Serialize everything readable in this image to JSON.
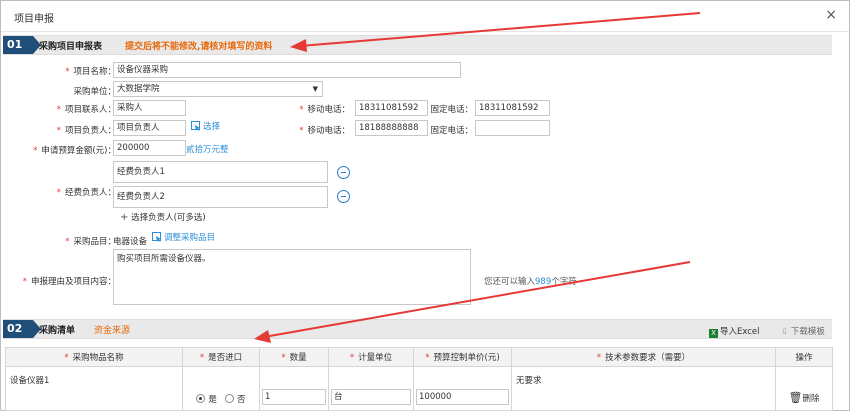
{
  "window": {
    "title": "项目申报",
    "close_glyph": "×"
  },
  "section1": {
    "num": "01",
    "title": "采购项目申报表",
    "note": "提交后将不能修改,请核对填写的资料"
  },
  "form": {
    "project_name_label": "项目名称：",
    "project_name": "设备仪器采购",
    "unit_label": "采购单位：",
    "unit": "大数据学院",
    "contact_label": "项目联系人：",
    "contact": "采购人",
    "mobile1_label": "移动电话：",
    "mobile1": "18311081592",
    "phone1_label": "固定电话：",
    "phone1": "18311081592",
    "leader_label": "项目负责人：",
    "leader": "项目负责人",
    "select_link": "选择",
    "mobile2_label": "移动电话：",
    "mobile2": "18188888888",
    "phone2_label": "固定电话：",
    "phone2": "",
    "budget_label": "申请预算金额(元)：",
    "budget": "200000",
    "budget_hint": "贰拾万元整",
    "fund_label": "经费负责人：",
    "fund_person1": "经费负责人1",
    "fund_person2": "经费负责人2",
    "add_fund": "选择负责人(可多选)",
    "category_label": "采购品目：",
    "category": "电器设备",
    "adjust_category": "调整采购品目",
    "reason_label": "申报理由及项目内容：",
    "reason": "购买项目所需设备仪器。",
    "remaining_prefix": "您还可以输入",
    "remaining_count": "989",
    "remaining_suffix": "个字符"
  },
  "section2": {
    "num": "02",
    "title": "采购清单",
    "note": "资金来源",
    "import_excel": "导入Excel",
    "download_template": "下载模板"
  },
  "table": {
    "headers": [
      "采购物品名称",
      "是否进口",
      "数量",
      "计量单位",
      "预算控制单价(元)",
      "技术参数要求（需要）",
      "操作"
    ],
    "rows": [
      {
        "name": "设备仪器1",
        "import_yes": "是",
        "import_no": "否",
        "qty": "1",
        "unit": "台",
        "price": "100000",
        "spec": "无要求",
        "delete": "删除"
      }
    ]
  },
  "colors": {
    "accent": "#1f4e79",
    "note": "#e8690b",
    "link": "#2a8fd8",
    "arrow": "#e53935"
  }
}
